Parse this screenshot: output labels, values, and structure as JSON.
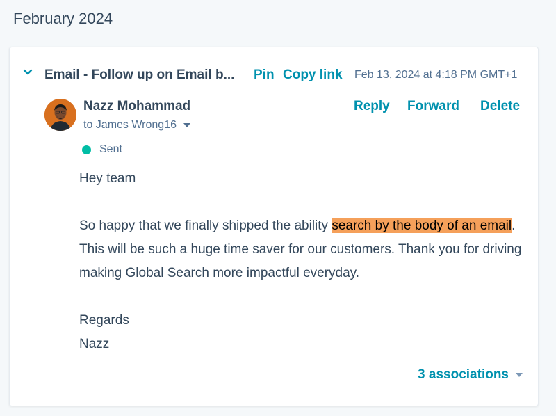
{
  "timeline": {
    "month_heading": "February 2024"
  },
  "activity": {
    "title": "Email - Follow up on Email b...",
    "pin_label": "Pin",
    "copy_link_label": "Copy link",
    "timestamp": "Feb 13, 2024 at 4:18 PM GMT+1",
    "sender": "Nazz Mohammad",
    "recipient": "to James Wrong16",
    "reply_label": "Reply",
    "forward_label": "Forward",
    "delete_label": "Delete",
    "status": "Sent",
    "status_color": "#00bda5",
    "body": {
      "greeting": "Hey team",
      "para_before": "So happy that we finally shipped the ability ",
      "para_highlight": "search by the body of an email",
      "para_after": ". This will be such a huge time saver for our customers. Thank you for driving making Global Search more impactful everyday.",
      "signoff": "Regards",
      "signature": "Nazz"
    },
    "associations_label": "3 associations"
  },
  "colors": {
    "link": "#0091ae",
    "text": "#33475b",
    "highlight": "#f5a05a"
  }
}
